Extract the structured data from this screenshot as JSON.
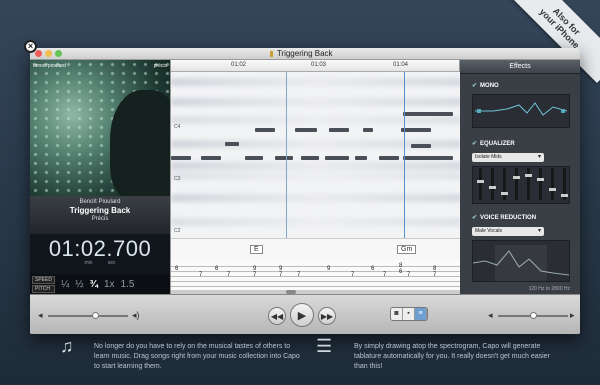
{
  "promo": {
    "ribbon_line1": "Also for",
    "ribbon_line2": "your iPhone"
  },
  "window": {
    "title": "Triggering Back"
  },
  "album": {
    "cover_artist": "benoit pioulard",
    "cover_album": "précis",
    "artist": "Benoît Pioulard",
    "track": "Triggering Back",
    "album": "Précis"
  },
  "clock": {
    "time": "01:02.700",
    "unit_min": "min",
    "unit_sec": "sec"
  },
  "speed": {
    "speed_label": "SPEED",
    "pitch_label": "PITCH",
    "options": [
      "¼",
      "½",
      "¾",
      "1x",
      "1.5"
    ],
    "selected": "¾"
  },
  "timeline": {
    "marks": [
      "01:02",
      "01:03",
      "01:04"
    ]
  },
  "notes_axis": [
    "C4",
    "C3",
    "C2"
  ],
  "chords": [
    "E",
    "Gm"
  ],
  "tablature": {
    "top": [
      "6",
      "6",
      "9",
      "9",
      "9",
      "6",
      "8",
      "8"
    ],
    "bottom": [
      "7",
      "7",
      "7",
      "7",
      "7",
      "7",
      "7",
      "7",
      "6",
      "7"
    ]
  },
  "effects": {
    "header": "Effects",
    "mono": "MONO",
    "equalizer": "EQUALIZER",
    "eq_preset": "Isolate Mids",
    "voice": "VOICE REDUCTION",
    "voice_preset": "Male Vocals",
    "freq_range": "120 Hz to 2800 Hz"
  },
  "below": {
    "left_text": "No longer do you have to rely on the musical tastes of others to learn music. Drag songs right from your music collection into Capo to start learning them.",
    "right_text": "By simply drawing atop the spectrogram, Capo will generate tablature automatically for you. It really doesn't get much easier than this!"
  }
}
